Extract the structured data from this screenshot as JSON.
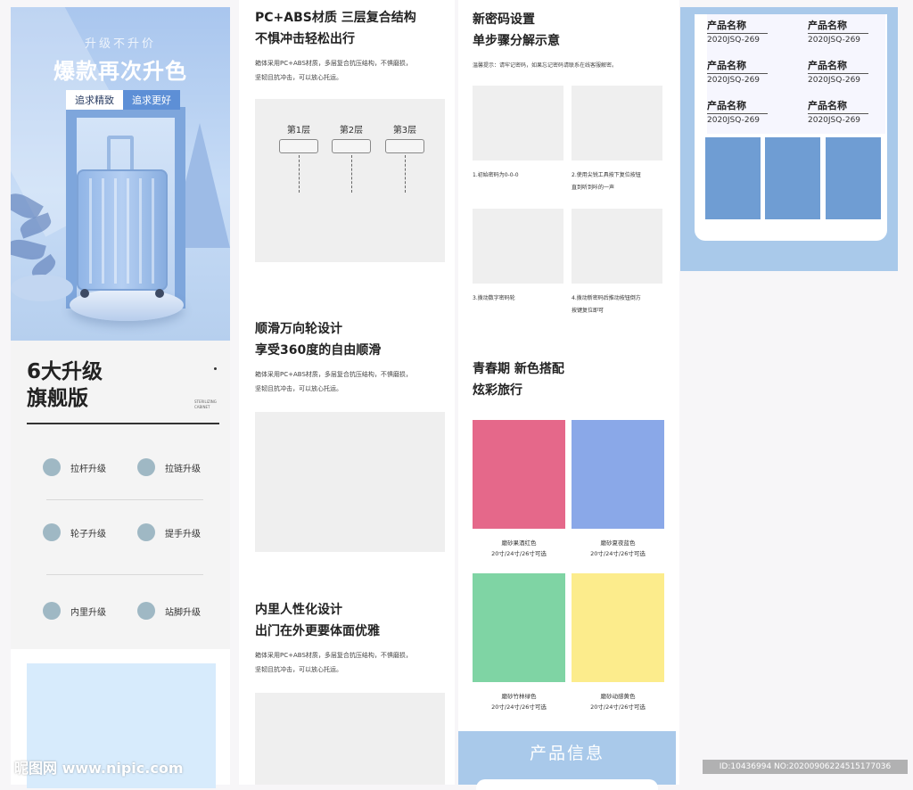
{
  "hero": {
    "subtitle": "升级不升价",
    "title": "爆款再次升色",
    "btn_left": "追求精致",
    "btn_right": "追求更好"
  },
  "upgrades": {
    "title": "6大升级\n旗舰版",
    "english": "STERILIZING CABINET",
    "items": [
      "拉杆升级",
      "拉链升级",
      "轮子升级",
      "提手升级",
      "内里升级",
      "站脚升级"
    ]
  },
  "features": [
    {
      "title": "PC+ABS材质 三层复合结构\n不惧冲击轻松出行",
      "desc": "箱体采用PC+ABS材质，多层复合抗压结构，不惧磨损，\n坚韧且抗冲击，可以放心托运。",
      "layers": [
        "第1层",
        "第2层",
        "第3层"
      ]
    },
    {
      "title": "顺滑万向轮设计\n享受360度的自由顺滑",
      "desc": "箱体采用PC+ABS材质，多层复合抗压结构，不惧磨损，\n坚韧且抗冲击，可以放心托运。"
    },
    {
      "title": "内里人性化设计\n出门在外更要体面优雅",
      "desc": "箱体采用PC+ABS材质，多层复合抗压结构，不惧磨损，\n坚韧且抗冲击，可以放心托运。"
    }
  ],
  "password": {
    "title": "新密码设置\n单步骤分解示意",
    "tip": "温馨提示：请牢记密码，如果忘记密码请联系在线客服解密。",
    "steps": [
      "1.初始密码为0-0-0",
      "2.使用尖锐工具按下复位按钮\n直到听到咔的一声",
      "3.拨动数字密码轮",
      "4.拨动新密码后推动按钮倒方\n按键复位即可"
    ]
  },
  "colors": {
    "title": "青春期 新色搭配\n炫彩旅行",
    "swatches": [
      {
        "name": "磨砂果酒红色",
        "sizes": "20寸/24寸/26寸可选",
        "color": "#e5688a"
      },
      {
        "name": "磨砂夏夜蓝色",
        "sizes": "20寸/24寸/26寸可选",
        "color": "#8aa8e8"
      },
      {
        "name": "磨砂竹林绿色",
        "sizes": "20寸/24寸/26寸可选",
        "color": "#7fd4a4"
      },
      {
        "name": "磨砂动感黄色",
        "sizes": "20寸/24寸/26寸可选",
        "color": "#fcec8c"
      }
    ]
  },
  "product_info": {
    "title": "产品信息",
    "entries": [
      {
        "name": "产品名称",
        "code": "2020JSQ-269"
      },
      {
        "name": "产品名称",
        "code": "2020JSQ-269"
      },
      {
        "name": "产品名称",
        "code": "2020JSQ-269"
      },
      {
        "name": "产品名称",
        "code": "2020JSQ-269"
      },
      {
        "name": "产品名称",
        "code": "2020JSQ-269"
      },
      {
        "name": "产品名称",
        "code": "2020JSQ-269"
      }
    ]
  },
  "watermark": {
    "left": "昵图网 www.nipic.com",
    "right": "ID:10436994 NO:20200906224515177036"
  }
}
